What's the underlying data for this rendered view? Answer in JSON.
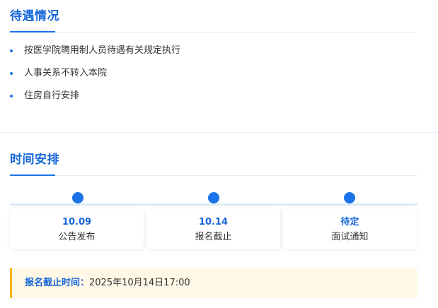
{
  "benefits_section": {
    "title": "待遇情况",
    "items": [
      "按医学院聘用制人员待遇有关规定执行",
      "人事关系不转入本院",
      "住房自行安排"
    ]
  },
  "schedule_section": {
    "title": "时间安排",
    "steps": [
      {
        "date": "10.09",
        "label": "公告发布"
      },
      {
        "date": "10.14",
        "label": "报名截止"
      },
      {
        "date": "待定",
        "label": "面试通知"
      }
    ]
  },
  "deadline_notice": {
    "label": "报名截止时间：",
    "value": "2025年10月14日17:00"
  },
  "colors": {
    "accent": "#1a73e8",
    "notice_border": "#f5b400",
    "notice_bg": "#fff8e6"
  }
}
